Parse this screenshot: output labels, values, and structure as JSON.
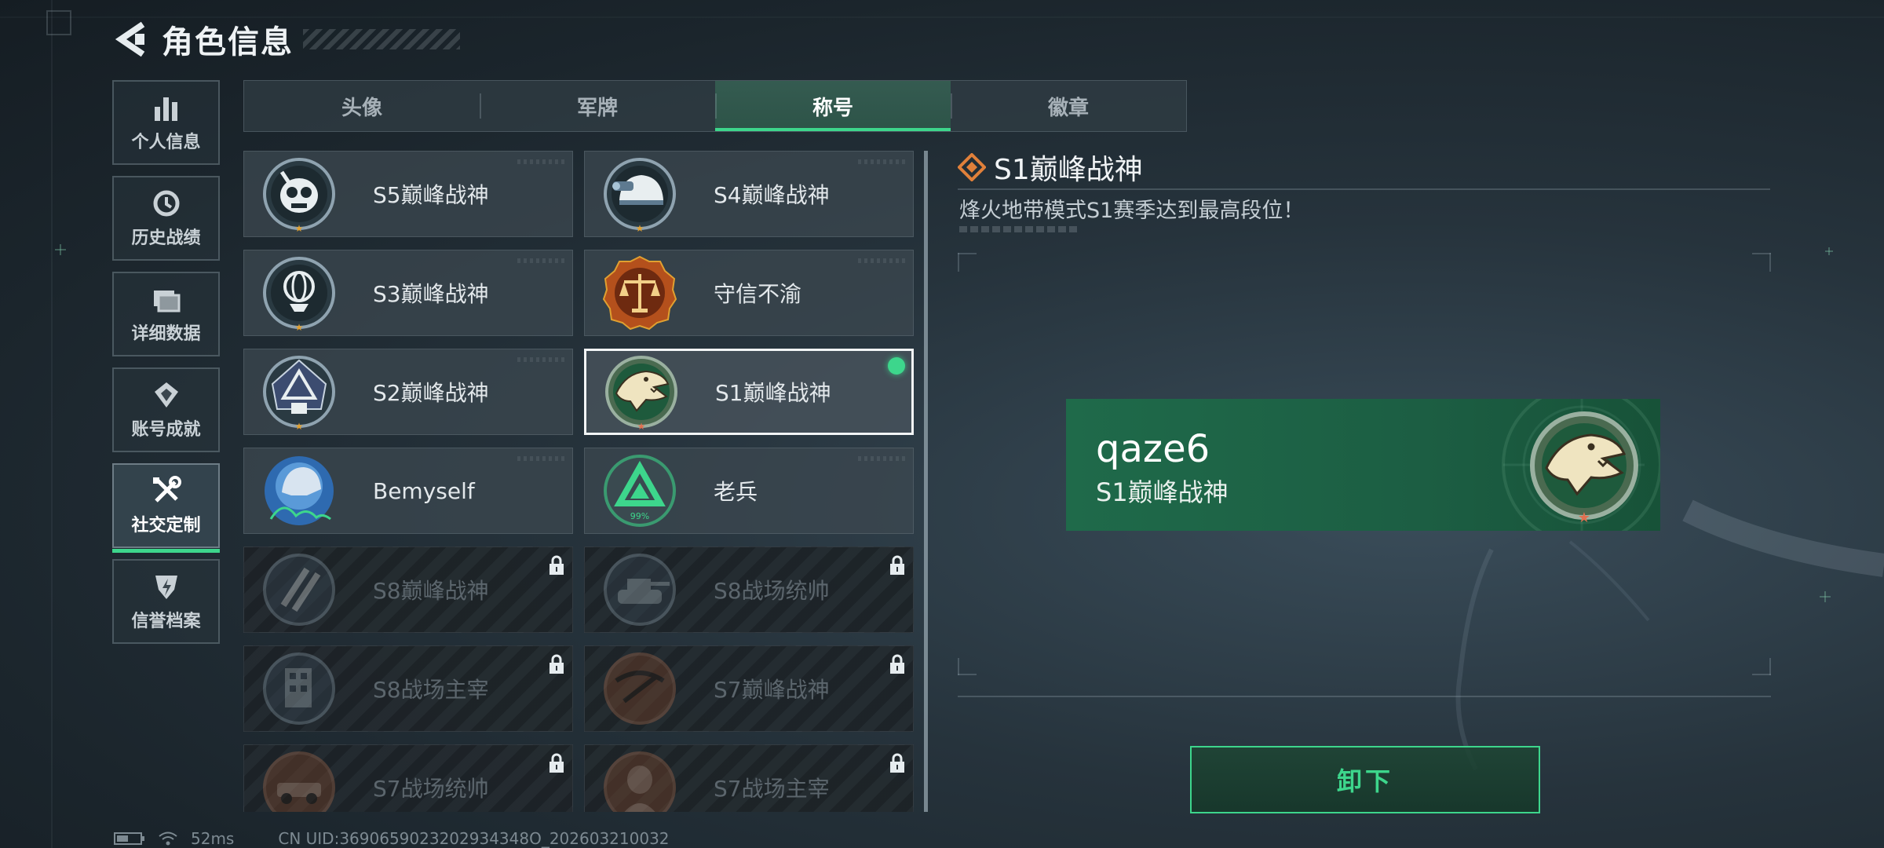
{
  "header": {
    "title": "角色信息",
    "back_icon": "back-arrow-icon"
  },
  "sidenav": {
    "items": [
      {
        "label": "个人信息",
        "icon": "bar-chart-icon",
        "active": false
      },
      {
        "label": "历史战绩",
        "icon": "history-clock-icon",
        "active": false
      },
      {
        "label": "详细数据",
        "icon": "folder-icon",
        "active": false
      },
      {
        "label": "账号成就",
        "icon": "achievement-icon",
        "active": false
      },
      {
        "label": "社交定制",
        "icon": "wrench-screwdriver-icon",
        "active": true
      },
      {
        "label": "信誉档案",
        "icon": "credit-shield-icon",
        "active": false
      }
    ]
  },
  "tabs": [
    {
      "label": "头像",
      "active": false
    },
    {
      "label": "军牌",
      "active": false
    },
    {
      "label": "称号",
      "active": true
    },
    {
      "label": "徽章",
      "active": false
    }
  ],
  "titles": [
    {
      "label": "S5巅峰战神",
      "emblem": "skull-mask-emblem",
      "locked": false,
      "selected": false
    },
    {
      "label": "S4巅峰战神",
      "emblem": "night-vision-helmet-emblem",
      "locked": false,
      "selected": false
    },
    {
      "label": "S3巅峰战神",
      "emblem": "globe-trophy-emblem",
      "locked": false,
      "selected": false
    },
    {
      "label": "守信不渝",
      "emblem": "scales-emblem",
      "locked": false,
      "selected": false
    },
    {
      "label": "S2巅峰战神",
      "emblem": "triangle-tower-emblem",
      "locked": false,
      "selected": false
    },
    {
      "label": "S1巅峰战神",
      "emblem": "crocodile-emblem",
      "locked": false,
      "selected": true
    },
    {
      "label": "Bemyself",
      "emblem": "signature-helmet-emblem",
      "locked": false,
      "selected": false
    },
    {
      "label": "老兵",
      "emblem": "veteran-triangle-emblem",
      "emblem_text": "99%",
      "locked": false,
      "selected": false
    },
    {
      "label": "S8巅峰战神",
      "emblem": "slash-emblem",
      "locked": true,
      "selected": false
    },
    {
      "label": "S8战场统帅",
      "emblem": "tank-emblem",
      "locked": true,
      "selected": false
    },
    {
      "label": "S8战场主宰",
      "emblem": "building-emblem",
      "locked": true,
      "selected": false
    },
    {
      "label": "S7巅峰战神",
      "emblem": "crossbow-emblem",
      "locked": true,
      "selected": false
    },
    {
      "label": "S7战场统帅",
      "emblem": "vehicle-emblem",
      "locked": true,
      "selected": false
    },
    {
      "label": "S7战场主宰",
      "emblem": "soldier-emblem",
      "locked": true,
      "selected": false
    }
  ],
  "detail": {
    "title": "S1巅峰战神",
    "description": "烽火地带模式S1赛季达到最高段位！",
    "preview_name": "qaze6",
    "preview_title": "S1巅峰战神",
    "action_label": "卸下"
  },
  "status": {
    "ping": "52ms",
    "uid": "CN UID:3690659023202934348O_202603210032"
  },
  "colors": {
    "accent": "#3dd68c",
    "title_icon": "#e0803a",
    "preview_bg": "#1f6a4a"
  }
}
